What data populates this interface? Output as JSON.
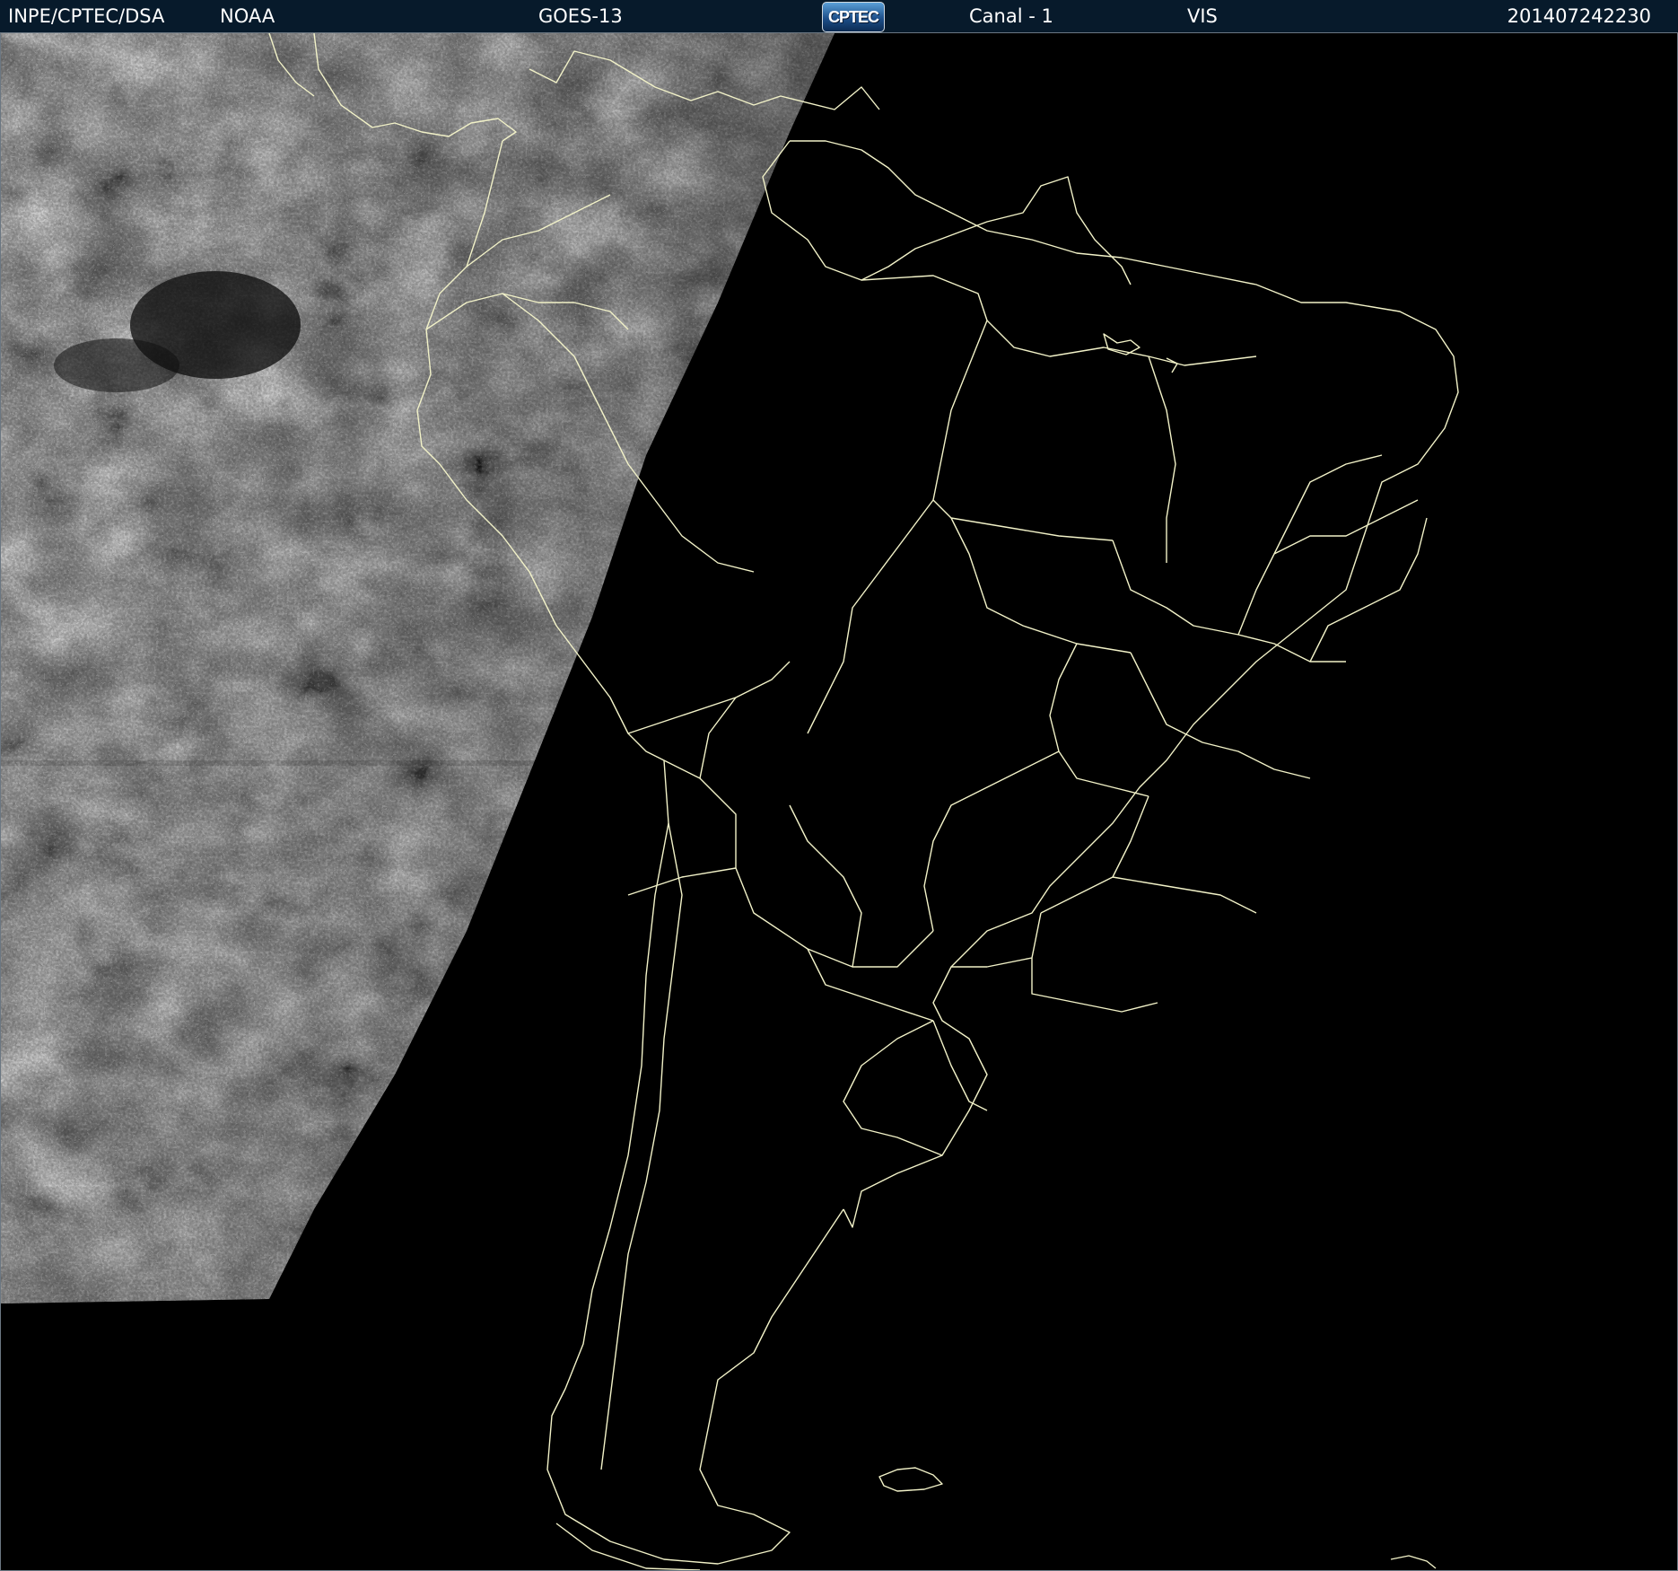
{
  "header": {
    "agency": "INPE/CPTEC/DSA",
    "provider": "NOAA",
    "satellite": "GOES-13",
    "logo_text": "CPTEC",
    "channel": "Canal - 1",
    "band": "VIS",
    "datetime": "201407242230"
  },
  "colors": {
    "header_background": "#071a2b",
    "header_text": "#ffffff",
    "map_background": "#000000",
    "boundary_line": "#f2f2c8",
    "cloud_bright": "#e6e6e6",
    "cloud_dim": "#4a4a4a"
  },
  "map": {
    "type": "satellite-visible-image",
    "region": "South America",
    "night_side": "east"
  }
}
